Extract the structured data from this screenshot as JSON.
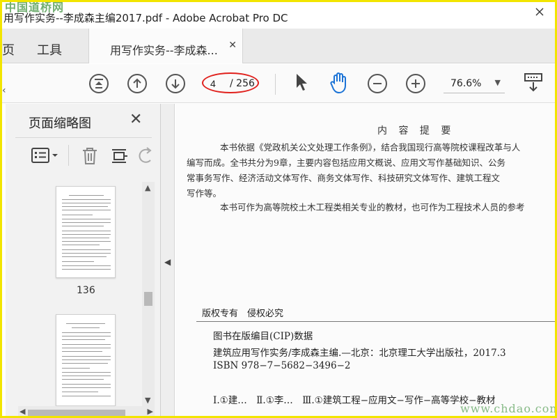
{
  "window": {
    "title": "用写作实务--李成森主编2017.pdf - Adobe Acrobat Pro DC",
    "watermark_top": "中国道桥网",
    "watermark_bottom": "www.chdao.com"
  },
  "tabs": {
    "home": "页",
    "tools": "工具",
    "document": "用写作实务--李成森..."
  },
  "toolbar": {
    "page_current": "4",
    "page_total": "/ 256",
    "zoom": "76.6%",
    "highlight_color": "#e0201c",
    "active_tool": "hand-tool"
  },
  "sidepanel": {
    "title": "页面缩略图",
    "thumbnails": [
      {
        "page_label": "136"
      }
    ]
  },
  "document": {
    "heading": "内 容 提 要",
    "paragraph1": [
      "本书依据《党政机关公文处理工作条例》，结合我国现行高等院校课程改革与人",
      "编写而成。全书共分为9章，主要内容包括应用文概说、应用文写作基础知识、公务",
      "常事务写作、经济活动文体写作、商务文体写作、科技研究文体写作、建筑工程文",
      "写作等。"
    ],
    "paragraph2": "本书可作为高等院校土木工程类相关专业的教材，也可作为工程技术人员的参考",
    "rights": "版权专有　侵权必究",
    "cip": [
      "图书在版编目(CIP)数据",
      "建筑应用写作实务/李成森主编.—北京：北京理工大学出版社，2017.3",
      "ISBN  978−7−5682−3496−2",
      "Ⅰ.①建…　Ⅱ.①李…　Ⅲ.①建筑工程−应用文−写作−高等学校−教材"
    ]
  }
}
